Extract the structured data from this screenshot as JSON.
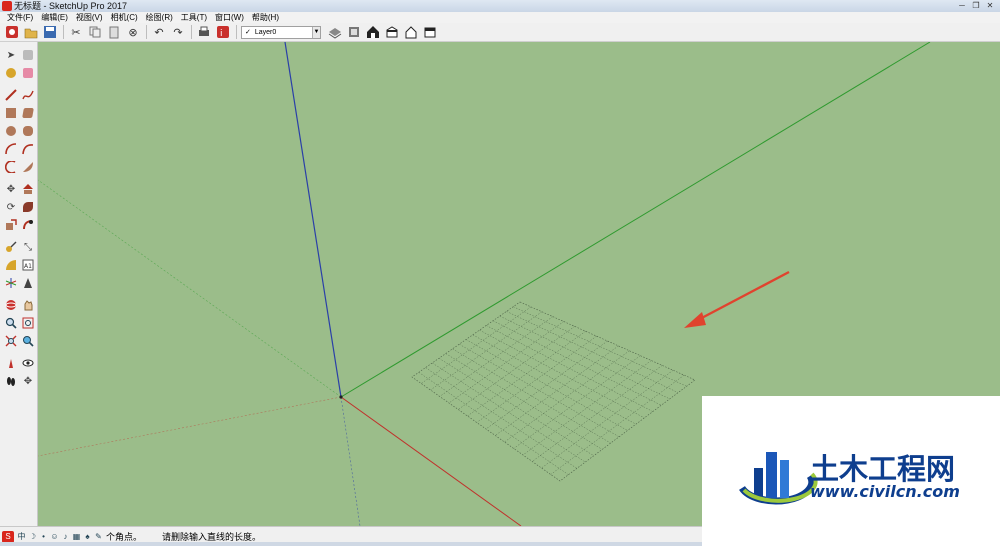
{
  "window": {
    "title": "无标题 - SketchUp Pro 2017",
    "buttons": [
      "─",
      "❐",
      "✕"
    ]
  },
  "menu": [
    "文件(F)",
    "编辑(E)",
    "视图(V)",
    "相机(C)",
    "绘图(R)",
    "工具(T)",
    "窗口(W)",
    "帮助(H)"
  ],
  "toolbar": {
    "layer": {
      "check": "✓",
      "value": "Layer0"
    }
  },
  "status": {
    "ime_label": "S",
    "ime_mode": "中",
    "corner_text": "个角点。",
    "prompt": "请删除输入直线的长度。"
  },
  "watermark": {
    "name": "土木工程网",
    "url": "www.civilcn.com"
  },
  "colors": {
    "viewport_bg": "#9bbd8a",
    "axis_blue": "#2a3fa8",
    "axis_green": "#2f9a2f",
    "axis_red": "#c0312b",
    "arrow_red": "#e0432e",
    "brand_blue": "#0e3e8e"
  }
}
